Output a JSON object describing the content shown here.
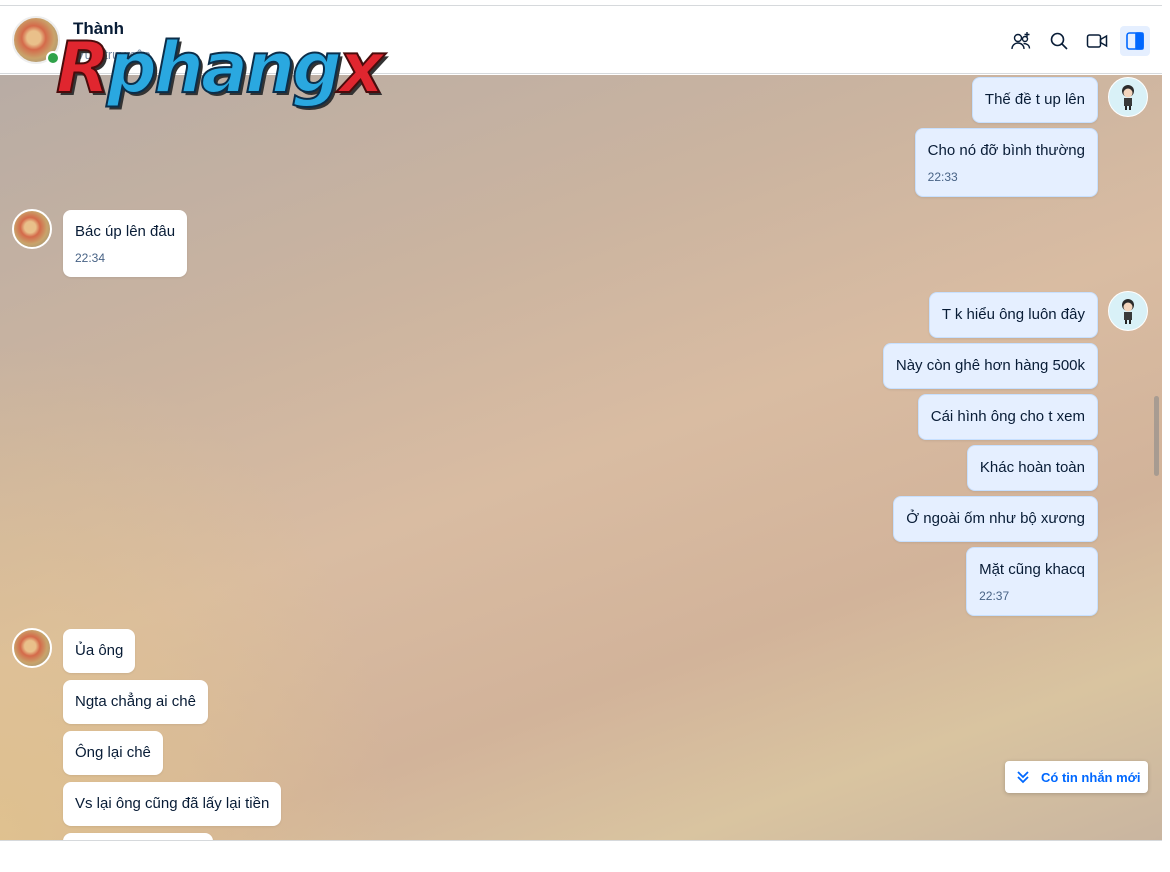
{
  "header": {
    "name": "Thành",
    "status": "Vừa truy cập"
  },
  "watermark": {
    "text": "Rphangx"
  },
  "messages": [
    {
      "text": "Thế đề t up lên"
    },
    {
      "text": "Cho nó đỡ bình thường",
      "time": "22:33"
    },
    {
      "text": "Bác úp lên đâu",
      "time": "22:34"
    },
    {
      "text": "T k hiểu ông luôn đây"
    },
    {
      "text": "Này còn ghê hơn hàng 500k"
    },
    {
      "text": "Cái hình ông cho t xem"
    },
    {
      "text": "Khác hoàn toàn"
    },
    {
      "text": "Ở ngoài ốm như bộ xương"
    },
    {
      "text": "Mặt cũng khacq",
      "time": "22:37"
    },
    {
      "text": "Ủa ông"
    },
    {
      "text": "Ngta chẳng ai chê"
    },
    {
      "text": "Ông lại chê"
    },
    {
      "text": "Vs lại ông cũng đã lấy lại tiền"
    }
  ],
  "new_message_button": {
    "label": "Có tin nhắn mới"
  },
  "colors": {
    "accent": "#0068ff",
    "my_bubble": "#e5efff",
    "their_bubble": "#ffffff",
    "online": "#30a24a"
  },
  "icons": [
    "add-member-icon",
    "search-icon",
    "video-call-icon",
    "sidebar-toggle-icon",
    "double-chevron-down-icon"
  ]
}
